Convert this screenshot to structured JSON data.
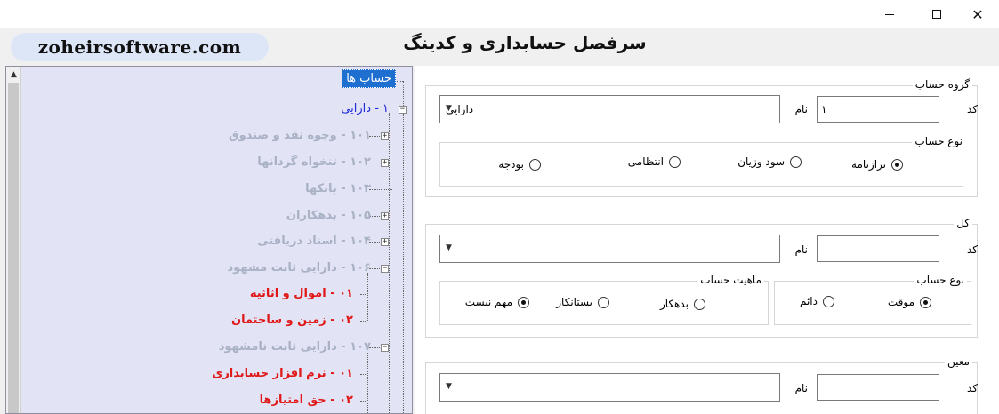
{
  "window": {
    "controls": [
      "minimize",
      "maximize",
      "close"
    ],
    "close_glyph": "✕"
  },
  "header": {
    "brand": "zoheirsoftware.com",
    "title": "سرفصل حسابداری و کدینگ"
  },
  "tree": {
    "root": "حساب ها",
    "nodes": [
      {
        "label": "۱ - دارایی",
        "style": "blue"
      },
      {
        "label": "۱۰۱ - وجوه نقد و صندوق",
        "style": "gray"
      },
      {
        "label": "۱۰۲ - تنخواه گردانها",
        "style": "gray"
      },
      {
        "label": "۱۰۳ - بانکها",
        "style": "gray"
      },
      {
        "label": "۱۰۵ - بدهکاران",
        "style": "gray"
      },
      {
        "label": "۱۰۴ - اسناد دریافتی",
        "style": "gray"
      },
      {
        "label": "۱۰۶ - دارایی ثابت مشهود",
        "style": "gray"
      },
      {
        "label": "۰۱ - اموال و اثاثیه",
        "style": "red"
      },
      {
        "label": "۰۲ - زمین و ساختمان",
        "style": "red"
      },
      {
        "label": "۱۰۷ - دارایی ثابت نامشهود",
        "style": "gray"
      },
      {
        "label": "۰۱ - نرم افزار حسابداری",
        "style": "red"
      },
      {
        "label": "۰۲ - حق امتیازها",
        "style": "red"
      }
    ]
  },
  "form": {
    "group": {
      "legend": "گروه حساب",
      "code_label": "کد",
      "code_value": "۱",
      "name_label": "نام",
      "name_value": "دارایی",
      "type_legend": "نوع حساب",
      "type_options": [
        "ترازنامه",
        "سود وزیان",
        "انتظامی",
        "بودجه"
      ],
      "type_selected": 0
    },
    "kol": {
      "legend": "کل",
      "code_label": "کد",
      "code_value": "",
      "name_label": "نام",
      "name_value": "",
      "type_legend": "نوع حساب",
      "type_options": [
        "موقت",
        "دائم"
      ],
      "type_selected": 0,
      "nature_legend": "ماهیت حساب",
      "nature_options": [
        "بدهکار",
        "بستانکار",
        "مهم نیست"
      ],
      "nature_selected": 2
    },
    "moein": {
      "legend": "معین",
      "code_label": "کد",
      "code_value": "",
      "name_label": "نام",
      "name_value": ""
    }
  },
  "icons": {
    "combo_chevron": "chevron-down-icon",
    "tree_expander": "plus-minus-box-icon",
    "scroll_up": "arrow-up-icon"
  }
}
